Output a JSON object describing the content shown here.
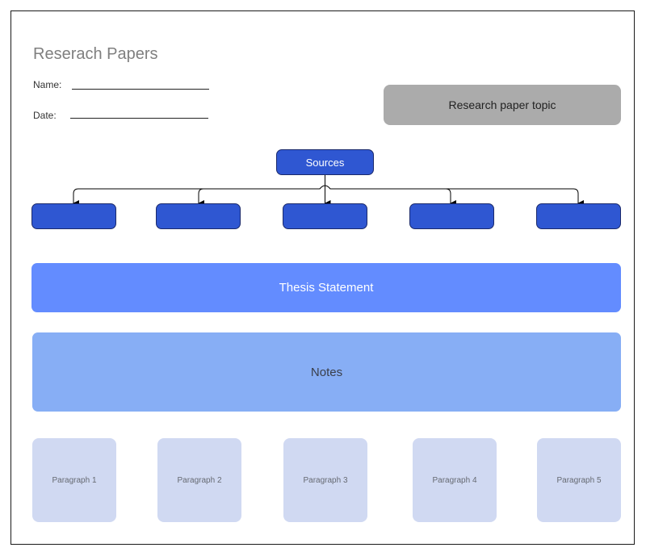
{
  "title": "Reserach Papers",
  "form": {
    "name_label": "Name:",
    "date_label": "Date:",
    "name_value": "",
    "date_value": ""
  },
  "topic_box": {
    "label": "Research paper topic",
    "color": "#ababab"
  },
  "sources": {
    "label": "Sources",
    "color": "#2f57d2",
    "children": [
      {
        "label": ""
      },
      {
        "label": ""
      },
      {
        "label": ""
      },
      {
        "label": ""
      },
      {
        "label": ""
      }
    ]
  },
  "thesis": {
    "label": "Thesis Statement",
    "color": "#638cff"
  },
  "notes": {
    "label": "Notes",
    "color": "#87aef5"
  },
  "paragraphs": [
    {
      "label": "Paragraph 1"
    },
    {
      "label": "Paragraph 2"
    },
    {
      "label": "Paragraph 3"
    },
    {
      "label": "Paragraph 4"
    },
    {
      "label": "Paragraph 5"
    }
  ]
}
